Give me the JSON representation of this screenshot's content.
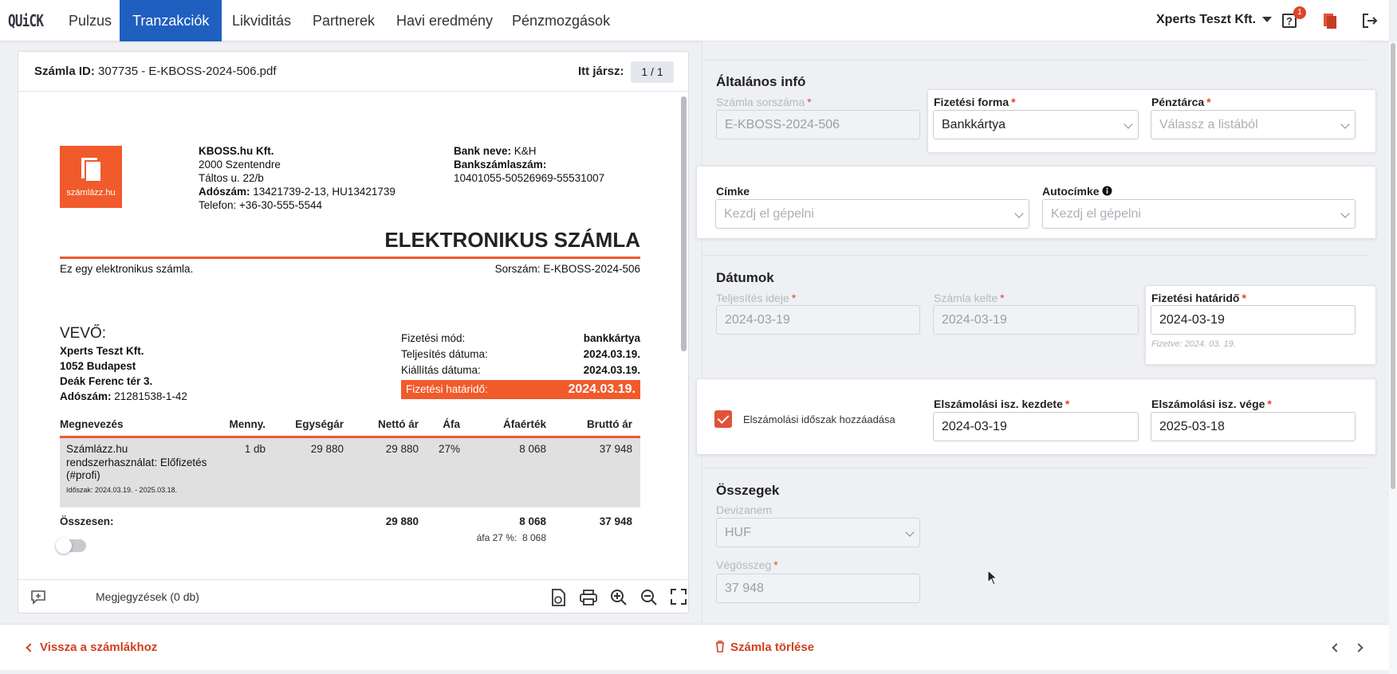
{
  "nav": {
    "logo": "QUiCK",
    "tabs": [
      "Pulzus",
      "Tranzakciók",
      "Likviditás",
      "Partnerek",
      "Havi eredmény",
      "Pénzmozgások"
    ],
    "active_tab": "Tranzakciók",
    "company": "Xperts Teszt Kft.",
    "help_badge": "1"
  },
  "viewer": {
    "invoice_id_label": "Számla ID:",
    "invoice_id_value": "307735 - E-KBOSS-2024-506.pdf",
    "here_label": "Itt jársz:",
    "page_indicator": "1 / 1",
    "notes_label": "Megjegyzések (0 db)"
  },
  "invoice": {
    "logo_text": "számlázz.hu",
    "seller_name": "KBOSS.hu Kft.",
    "seller_zip_city": "2000 Szentendre",
    "seller_street": "Táltos u. 22/b",
    "seller_tax_label": "Adószám:",
    "seller_tax": "13421739-2-13, HU13421739",
    "seller_phone": "Telefon: +36-30-555-5544",
    "bank_label": "Bank neve:",
    "bank_name": "K&H",
    "account_label": "Bankszámlaszám:",
    "account_number": "10401055-50526969-55531007",
    "title": "ELEKTRONIKUS SZÁMLA",
    "subtitle_left": "Ez egy elektronikus számla.",
    "serial_text": "Sorszám: E-KBOSS-2024-506",
    "buyer_heading": "VEVŐ:",
    "buyer_name": "Xperts Teszt Kft.",
    "buyer_city": "1052 Budapest",
    "buyer_street": "Deák Ferenc tér 3.",
    "buyer_tax_label": "Adószám:",
    "buyer_tax": "21281538-1-42",
    "pay_method_label": "Fizetési mód:",
    "pay_method": "bankkártya",
    "fulfil_label": "Teljesítés dátuma:",
    "fulfil_date": "2024.03.19.",
    "issue_label": "Kiállítás dátuma:",
    "issue_date": "2024.03.19.",
    "due_label": "Fizetési határidő:",
    "due_date": "2024.03.19.",
    "columns": [
      "Megnevezés",
      "Menny.",
      "Egységár",
      "Nettó ár",
      "Áfa",
      "Áfaérték",
      "Bruttó ár"
    ],
    "item_line1": "Számlázz.hu",
    "item_line2": "rendszerhasználat: Előfizetés",
    "item_line3": "(#profi)",
    "item_period": "Időszak: 2024.03.19. - 2025.03.18.",
    "item_qty": "1 db",
    "item_unit": "29 880",
    "item_net": "29 880",
    "item_vat_rate": "27%",
    "item_vat": "8 068",
    "item_gross": "37 948",
    "total_label": "Összesen:",
    "total_net": "29 880",
    "total_vat": "8 068",
    "total_gross": "37 948",
    "vat_breakdown_label": "áfa 27 %:",
    "vat_breakdown_value": "8 068"
  },
  "form": {
    "general_title": "Általános infó",
    "invoice_no_label": "Számla sorszáma",
    "invoice_no": "E-KBOSS-2024-506",
    "payment_label": "Fizetési forma",
    "payment_value": "Bankkártya",
    "wallet_label": "Pénztárca",
    "wallet_placeholder": "Válassz a listából",
    "tag_label": "Címke",
    "tag_placeholder": "Kezdj el gépelni",
    "autotag_label": "Autocímke",
    "autotag_placeholder": "Kezdj el gépelni",
    "dates_title": "Dátumok",
    "fulfil_label": "Teljesítés ideje",
    "fulfil_value": "2024-03-19",
    "issue_label": "Számla kelte",
    "issue_value": "2024-03-19",
    "due_label": "Fizetési határidő",
    "due_value": "2024-03-19",
    "paid_note": "Fizetve: 2024. 03. 19.",
    "period_check_label": "Elszámolási időszak hozzáadása",
    "period_start_label": "Elszámolási isz. kezdete",
    "period_start": "2024-03-19",
    "period_end_label": "Elszámolási isz. vége",
    "period_end": "2025-03-18",
    "amounts_title": "Összegek",
    "currency_label": "Devizanem",
    "currency_value": "HUF",
    "total_label": "Végösszeg",
    "total_value": "37 948"
  },
  "bottom": {
    "back_label": "Vissza a számlákhoz",
    "delete_label": "Számla törlése"
  }
}
